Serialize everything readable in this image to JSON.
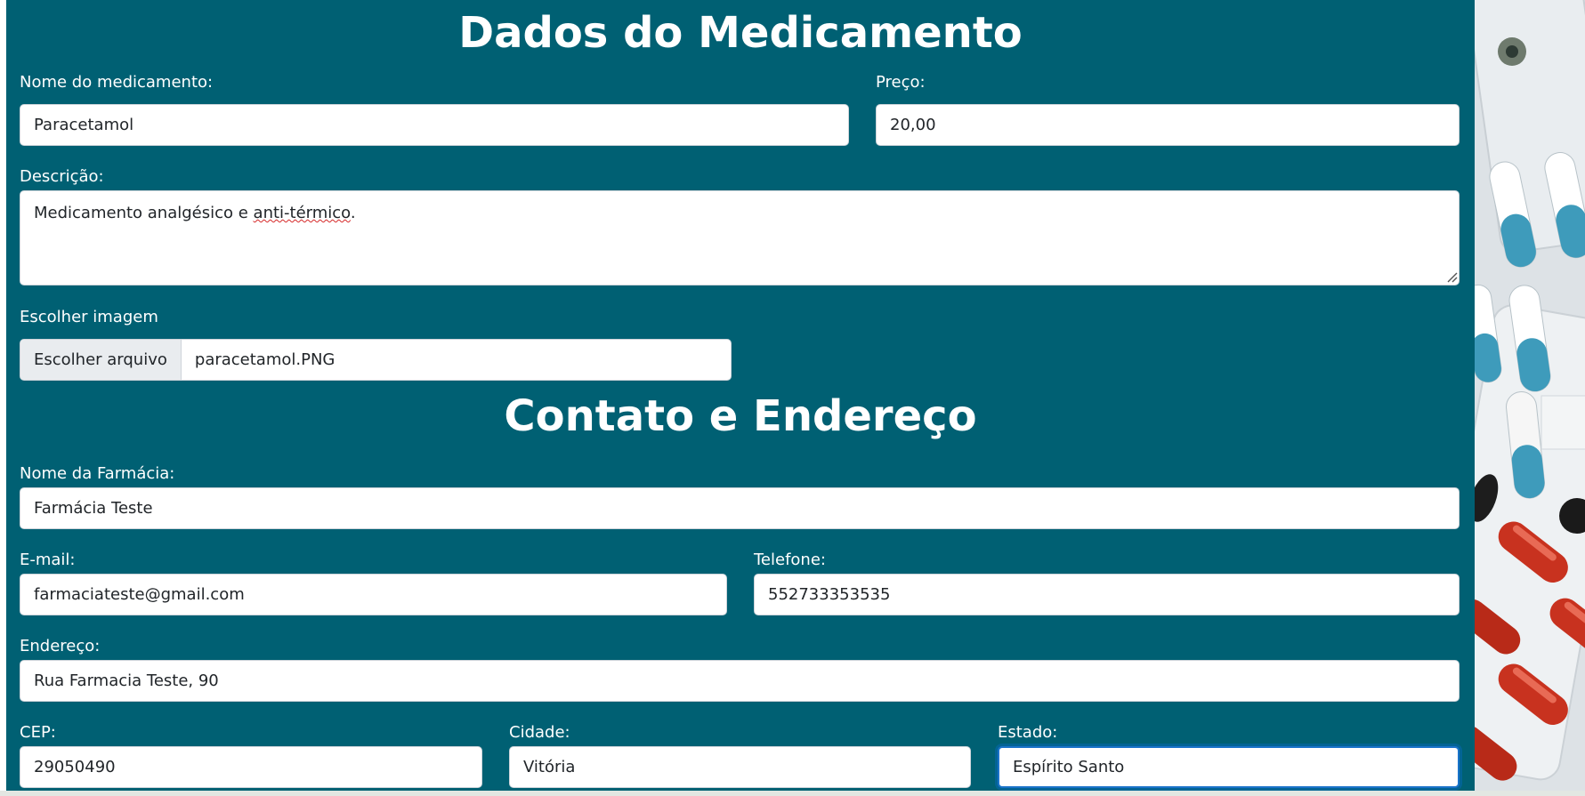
{
  "medicamento": {
    "title": "Dados do Medicamento",
    "nome_label": "Nome do medicamento:",
    "nome_value": "Paracetamol",
    "preco_label": "Preço:",
    "preco_value": "20,00",
    "descricao_label": "Descrição:",
    "descricao_prefix": "Medicamento analgésico e ",
    "descricao_flagged": "anti-térmico",
    "descricao_suffix": ".",
    "imagem_label": "Escolher imagem",
    "imagem_button": "Escolher arquivo",
    "imagem_file": "paracetamol.PNG"
  },
  "contato": {
    "title": "Contato e Endereço",
    "farmacia_label": "Nome da Farmácia:",
    "farmacia_value": "Farmácia Teste",
    "email_label": "E-mail:",
    "email_value": "farmaciateste@gmail.com",
    "telefone_label": "Telefone:",
    "telefone_value": "552733353535",
    "endereco_label": "Endereço:",
    "endereco_value": "Rua Farmacia Teste, 90",
    "cep_label": "CEP:",
    "cep_value": "29050490",
    "cidade_label": "Cidade:",
    "cidade_value": "Vitória",
    "estado_label": "Estado:",
    "estado_value": "Espírito Santo"
  },
  "colors": {
    "panel": "#006073",
    "field_border": "#ced4da",
    "focus_border": "#1a73c9",
    "file_button_bg": "#e9ecef"
  },
  "icons": {
    "textarea_corner": "resize-grip-icon",
    "side_image": "pill-blister-image"
  }
}
